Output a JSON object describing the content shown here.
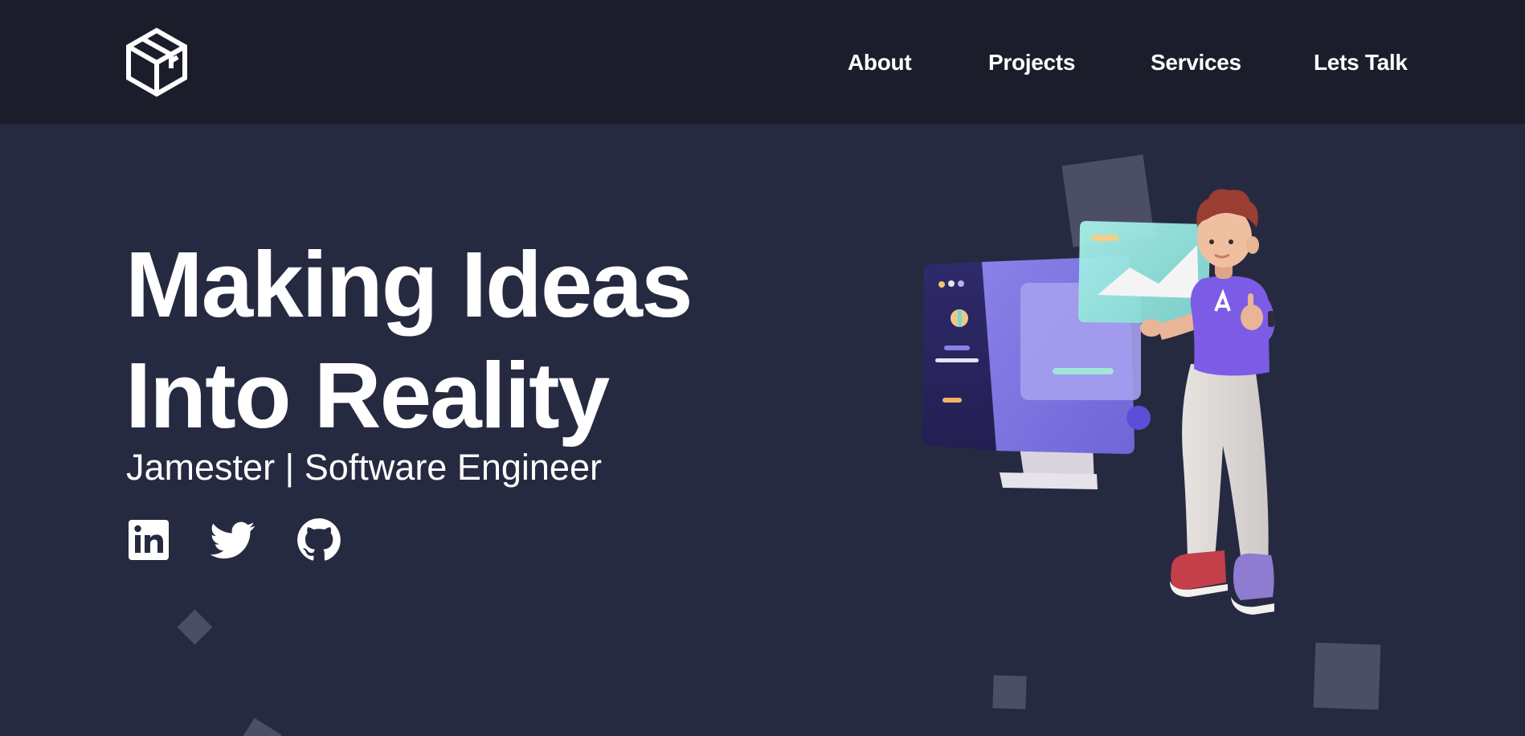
{
  "header": {
    "logo_icon": "cube-letter-logo-icon",
    "nav": [
      {
        "label": "About"
      },
      {
        "label": "Projects"
      },
      {
        "label": "Services"
      },
      {
        "label": "Lets Talk"
      }
    ]
  },
  "hero": {
    "headline_line1": "Making Ideas",
    "headline_line2": "Into Reality",
    "subtitle": "Jamester | Software Engineer",
    "social": [
      {
        "icon": "linkedin-icon"
      },
      {
        "icon": "twitter-icon"
      },
      {
        "icon": "github-icon"
      }
    ],
    "illustration": "developer-with-monitor-illustration"
  },
  "colors": {
    "header_bg": "#1b1d2b",
    "page_bg": "#262a40",
    "text": "#ffffff",
    "decor_square": "#4b4e65",
    "accent_purple": "#7b6fe0",
    "accent_teal": "#8fe0d8"
  }
}
